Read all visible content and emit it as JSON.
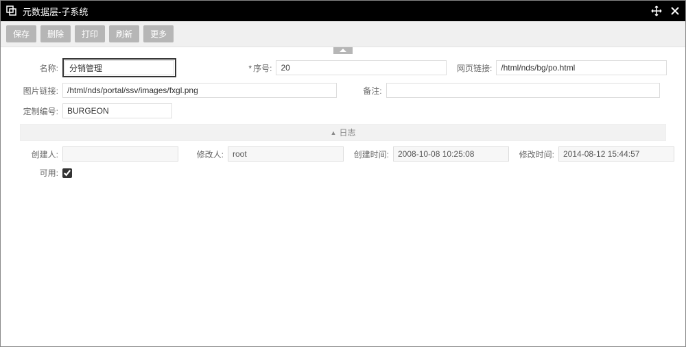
{
  "window": {
    "title": "元数据层-子系统"
  },
  "toolbar": {
    "save": "保存",
    "delete": "删除",
    "print": "打印",
    "refresh": "刷新",
    "more": "更多"
  },
  "form": {
    "labels": {
      "name": "名称:",
      "seq": "序号:",
      "weblink": "网页链接:",
      "imglink": "图片链接:",
      "remark": "备注:",
      "customno": "定制编号:"
    },
    "values": {
      "name": "分销管理",
      "seq": "20",
      "weblink": "/html/nds/bg/po.html",
      "imglink": "/html/nds/portal/ssv/images/fxgl.png",
      "remark": "",
      "customno": "BURGEON"
    },
    "required_mark": "*"
  },
  "log": {
    "section_title": "日志",
    "labels": {
      "creator": "创建人:",
      "modifier": "修改人:",
      "create_time": "创建时间:",
      "modify_time": "修改时间:",
      "usable": "可用:"
    },
    "values": {
      "creator": "",
      "modifier": "root",
      "create_time": "2008-10-08 10:25:08",
      "modify_time": "2014-08-12 15:44:57",
      "usable": true
    }
  }
}
